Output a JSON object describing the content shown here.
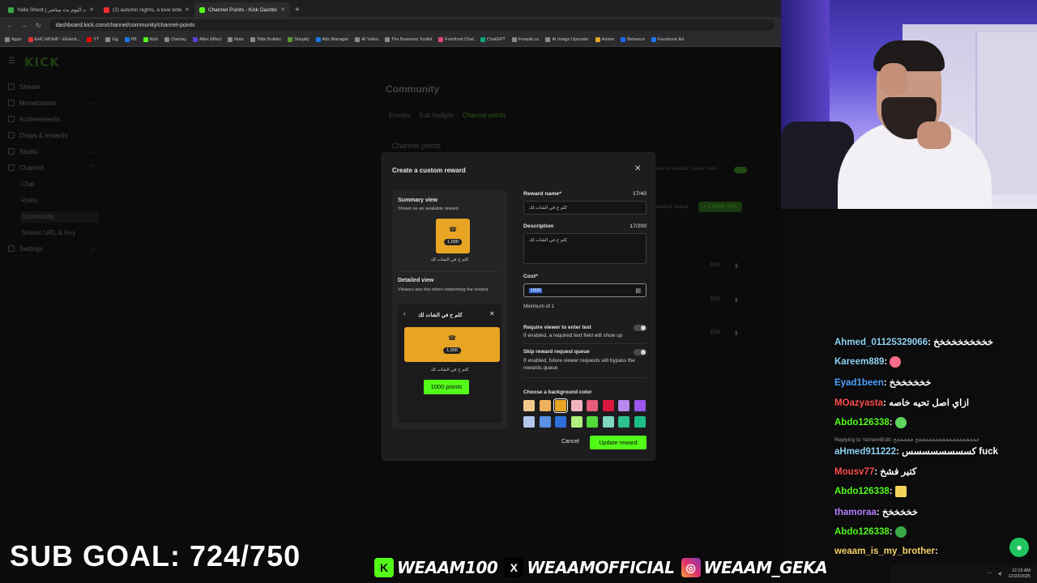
{
  "browser": {
    "tabs": [
      {
        "label": "Yalla Shoot | يلا شوت مباريات اليوم بث مباشر",
        "fav_color": "#3aa845"
      },
      {
        "label": "(2) autumn nights, a love letter",
        "fav_color": "#ff2d2d"
      },
      {
        "label": "Channel Points - Kick Dashboard",
        "fav_color": "#53fc18"
      }
    ],
    "url": "dashboard.kick.com/channel/community/channel-points",
    "bookmarks": [
      "Apps",
      "EHC-MOHP - EElectr...",
      "YT",
      "Gg",
      "FB",
      "Kick",
      "Overlay",
      "After Effect",
      "Note",
      "Tittle Builder",
      "Shopify",
      "Ads Manager",
      "AI Video",
      "The Business Toolkit",
      "Forefront Chat",
      "ChatGPT",
      "Freepik.co",
      "AI Image Upscaler",
      "Anime",
      "Behance",
      "Facebook Ad"
    ]
  },
  "kick": {
    "logo": "KICK",
    "sidebar": [
      {
        "label": "Stream"
      },
      {
        "label": "Monetization"
      },
      {
        "label": "Achievements"
      },
      {
        "label": "Drops & rewards"
      },
      {
        "label": "Studio"
      },
      {
        "label": "Channel"
      }
    ],
    "channel_sub": [
      "Chat",
      "Roles",
      "Community",
      "Stream URL & Key"
    ],
    "settings": "Settings",
    "page_title": "Community",
    "tabs": [
      "Emotes",
      "Sub badges",
      "Channel points"
    ],
    "section": "Channel points",
    "right_hint": "ard for rewards. Learn more",
    "request_queue": "equest queue",
    "create_new": "+ Create new",
    "edit": "Edit"
  },
  "modal": {
    "title": "Create a custom reward",
    "summary_title": "Summary view",
    "summary_sub": "Shown as an available reward",
    "cost_display": "1,000",
    "reward_name": "كلم ح في الشات لك",
    "detailed_title": "Detailed view",
    "detailed_sub": "Viewers see this when redeeming the reward",
    "points_button": "1000 points",
    "reward_name_label": "Reward name*",
    "reward_name_count": "17/40",
    "description_label": "Description",
    "description_count": "17/200",
    "description_value": "كلم ح في الشات لك",
    "cost_label": "Cost*",
    "cost_value": "1000",
    "cost_hint": "Minimum of 1",
    "require_text_label": "Require viewer to enter text",
    "require_text_hint": "If enabled, a required text field will show up",
    "skip_queue_label": "Skip reward request queue",
    "skip_queue_hint": "If enabled, future viewer requests will bypass the rewards queue",
    "color_label": "Choose a background color",
    "colors_row1": [
      "#f0c98b",
      "#edb05c",
      "#e8a524",
      "#f2b5c0",
      "#e35d7a",
      "#d9173f",
      "#b889f0",
      "#9b57ea"
    ],
    "colors_row2": [
      "#b5c7ef",
      "#5b8fe4",
      "#2f6fd9",
      "#aef07f",
      "#53d93a",
      "#7fd9c2",
      "#2cc08d",
      "#1bbf83"
    ],
    "selected_color": "#e8a524",
    "cancel": "Cancel",
    "update": "Update reward"
  },
  "chat": [
    {
      "user": "Ahmed_01125329066",
      "color": "#8fd3f4",
      "text": "خخخخخخخخخخ"
    },
    {
      "user": "Kareem889",
      "color": "#8fd3f4",
      "text": ""
    },
    {
      "user": "Eyad1been",
      "color": "#4da3ff",
      "text": "خخخخخخخ"
    },
    {
      "user": "MOazyasta",
      "color": "#ff4d4d",
      "text": "ازاي اصل تحيه خاصه"
    },
    {
      "user": "Abdo126338",
      "color": "#53fc18",
      "text": ""
    },
    {
      "user": "aHmed911222",
      "color": "#8fd3f4",
      "text": "كسسسسسسسس fuck"
    },
    {
      "user": "Mousv77",
      "color": "#ff4d4d",
      "text": "كتير فشخ"
    },
    {
      "user": "Abdo126338",
      "color": "#53fc18",
      "text": ""
    },
    {
      "user": "thamoraa",
      "color": "#b87fff",
      "text": "خخخخخخ"
    },
    {
      "user": "Abdo126338",
      "color": "#53fc18",
      "text": ""
    },
    {
      "user": "weaam_is_my_brother",
      "color": "#f7d26a",
      "text": ""
    }
  ],
  "reply_line": "Replying to Yamen4Edit: خخخخخخخخخخخخخخخخخخخ خخخخخخ",
  "overlay": {
    "sub_goal": "SUB GOAL: 724/750",
    "kick_handle": "WEAAM100",
    "x_handle": "WEAAMOFFICIAL",
    "ig_handle": "WEAAM_GEKA"
  },
  "taskbar": {
    "time": "12:15 AM",
    "date": "12/23/2025"
  }
}
